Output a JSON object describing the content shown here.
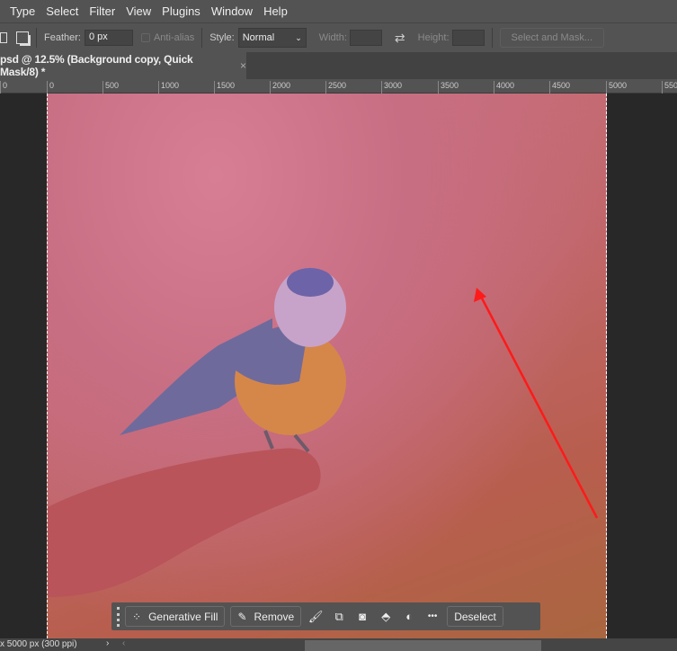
{
  "menu": [
    "Type",
    "Select",
    "Filter",
    "View",
    "Plugins",
    "Window",
    "Help"
  ],
  "options": {
    "feather_label": "Feather:",
    "feather_value": "0 px",
    "antialias": "Anti-alias",
    "style_label": "Style:",
    "style_value": "Normal",
    "width_label": "Width:",
    "height_label": "Height:",
    "select_mask": "Select and Mask..."
  },
  "tab": {
    "title": "psd @ 12.5% (Background copy, Quick Mask/8) *",
    "close": "×"
  },
  "ruler": [
    "0",
    "0",
    "500",
    "1000",
    "1500",
    "2000",
    "2500",
    "3000",
    "3500",
    "4000",
    "4500",
    "5000",
    "550"
  ],
  "context_bar": {
    "generative_fill": "Generative Fill",
    "remove": "Remove",
    "more": "•••",
    "deselect": "Deselect"
  },
  "status": {
    "doc_size": "x 5000 px (300 ppi)",
    "arrow": "›",
    "scroll_left": "‹"
  },
  "colors": {
    "annotation_arrow": "#ff1a1a",
    "quick_mask": "#c86e83"
  }
}
